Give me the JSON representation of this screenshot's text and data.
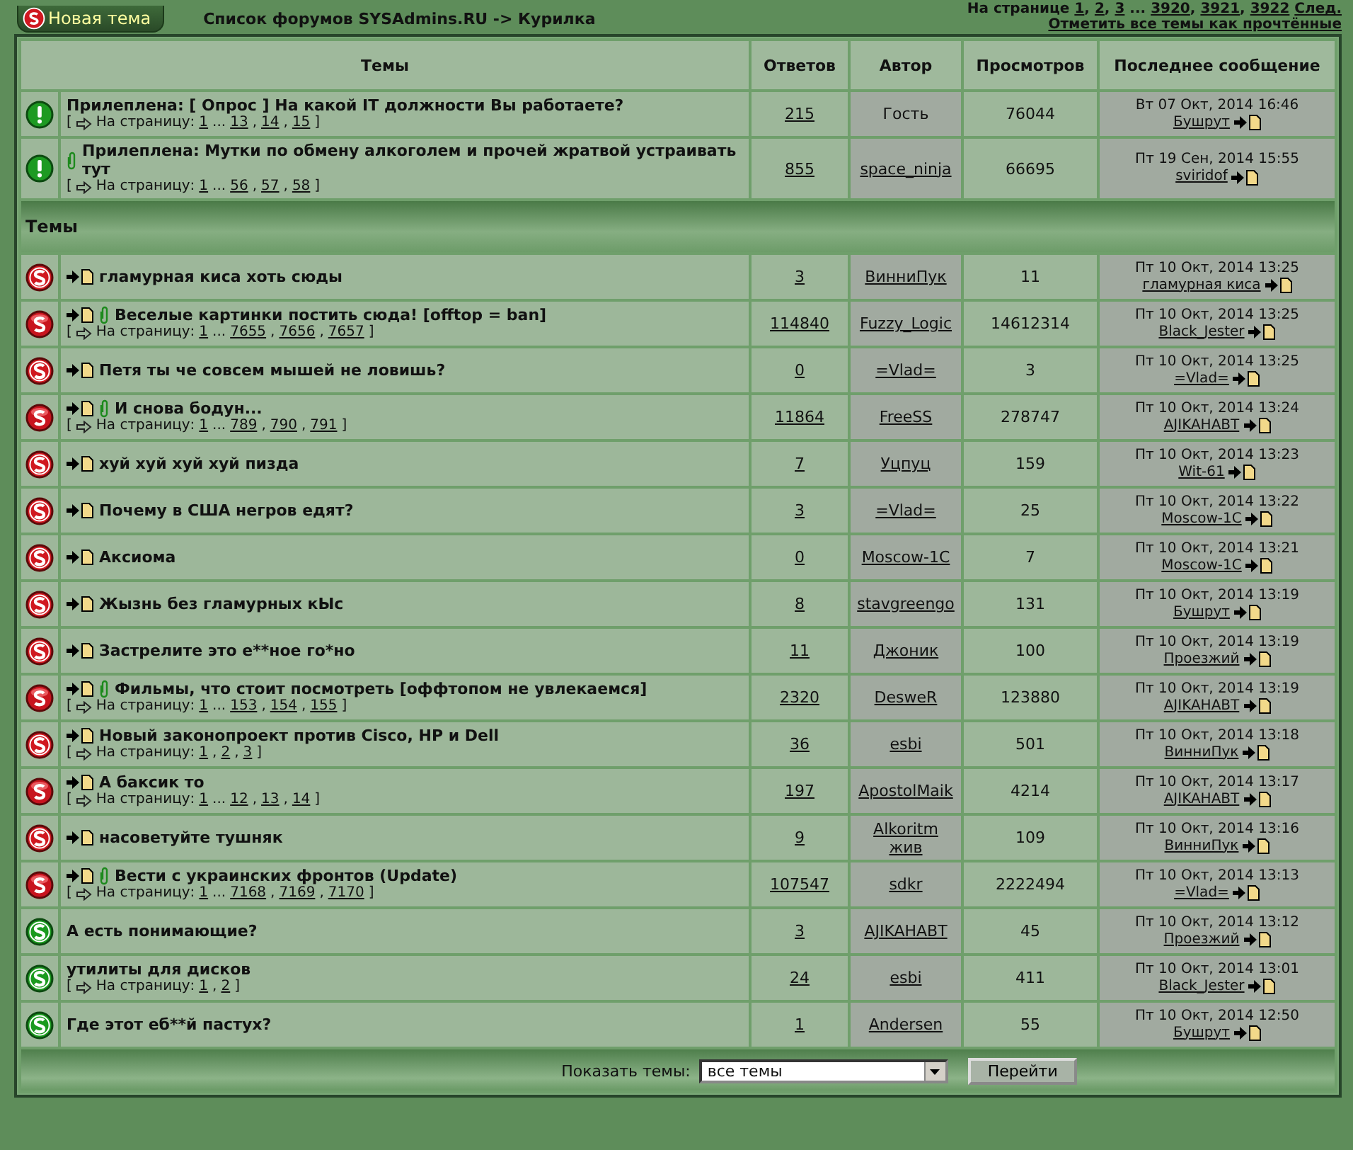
{
  "header": {
    "new_topic_button": "Новая тема",
    "breadcrumb": "Список форумов SYSAdmins.RU -> Курилка",
    "pager": {
      "label": "На странице",
      "links": [
        {
          "text": "1",
          "after": ","
        },
        {
          "text": "2",
          "after": ","
        },
        {
          "text": "3",
          "after": " ..."
        },
        {
          "text": "3920",
          "after": ","
        },
        {
          "text": "3921",
          "after": ","
        },
        {
          "text": "3922"
        }
      ],
      "next": "След."
    },
    "mark_read": "Отметить все темы как прочтённые"
  },
  "columns": [
    "Темы",
    "Ответов",
    "Автор",
    "Просмотров",
    "Последнее сообщение"
  ],
  "sticky_topics": [
    {
      "kind": "sticky",
      "new_posts": false,
      "attachment": false,
      "title": "Прилеплена: [ Опрос ] На какой IT должности Вы работаете?",
      "pager": {
        "open": "[",
        "label": "На страницу:",
        "links": [
          {
            "text": "1",
            "after": " ..."
          },
          {
            "text": "13",
            "after": ","
          },
          {
            "text": "14",
            "after": ","
          },
          {
            "text": "15"
          }
        ],
        "close": "]"
      },
      "replies": "215",
      "author": "Гость",
      "author_linked": false,
      "views": "76044",
      "last_date": "Вт 07 Окт, 2014 16:46",
      "last_user": "Бушрут"
    },
    {
      "kind": "sticky",
      "new_posts": false,
      "attachment": true,
      "title": "Прилеплена: Мутки по обмену алкоголем и прочей жратвой устраивать тут",
      "pager": {
        "open": "[",
        "label": "На страницу:",
        "links": [
          {
            "text": "1",
            "after": " ..."
          },
          {
            "text": "56",
            "after": ","
          },
          {
            "text": "57",
            "after": ","
          },
          {
            "text": "58"
          }
        ],
        "close": "]"
      },
      "replies": "855",
      "author": "space_ninja",
      "author_linked": true,
      "views": "66695",
      "last_date": "Пт 19 Сен, 2014 15:55",
      "last_user": "sviridof"
    }
  ],
  "section_title": "Темы",
  "topics": [
    {
      "kind": "hot",
      "new_posts": true,
      "attachment": false,
      "title": "гламурная киса хоть сюды",
      "replies": "3",
      "author": "ВинниПук",
      "author_linked": true,
      "views": "11",
      "last_date": "Пт 10 Окт, 2014 13:25",
      "last_user": "гламурная киса"
    },
    {
      "kind": "hot_paged",
      "new_posts": true,
      "attachment": true,
      "title": "Веселые картинки постить сюда! [offtop = ban]",
      "pager": {
        "open": "[",
        "label": "На страницу:",
        "links": [
          {
            "text": "1",
            "after": " ..."
          },
          {
            "text": "7655",
            "after": ","
          },
          {
            "text": "7656",
            "after": ","
          },
          {
            "text": "7657"
          }
        ],
        "close": "]"
      },
      "replies": "114840",
      "author": "Fuzzy_Logic",
      "author_linked": true,
      "views": "14612314",
      "last_date": "Пт 10 Окт, 2014 13:25",
      "last_user": "Black_Jester"
    },
    {
      "kind": "hot",
      "new_posts": true,
      "attachment": false,
      "title": "Петя ты че совсем мышей не ловишь?",
      "replies": "0",
      "author": "=Vlad=",
      "author_linked": true,
      "views": "3",
      "last_date": "Пт 10 Окт, 2014 13:25",
      "last_user": "=Vlad="
    },
    {
      "kind": "hot_paged",
      "new_posts": true,
      "attachment": true,
      "title": "И снова бодун...",
      "pager": {
        "open": "[",
        "label": "На страницу:",
        "links": [
          {
            "text": "1",
            "after": " ..."
          },
          {
            "text": "789",
            "after": ","
          },
          {
            "text": "790",
            "after": ","
          },
          {
            "text": "791"
          }
        ],
        "close": "]"
      },
      "replies": "11864",
      "author": "FreeSS",
      "author_linked": true,
      "views": "278747",
      "last_date": "Пт 10 Окт, 2014 13:24",
      "last_user": "AJIKAHABT"
    },
    {
      "kind": "hot",
      "new_posts": true,
      "attachment": false,
      "title": "хуй хуй хуй хуй пизда",
      "replies": "7",
      "author": "Уцпуц",
      "author_linked": true,
      "views": "159",
      "last_date": "Пт 10 Окт, 2014 13:23",
      "last_user": "Wit-61"
    },
    {
      "kind": "hot",
      "new_posts": true,
      "attachment": false,
      "title": "Почему в США негров едят?",
      "replies": "3",
      "author": "=Vlad=",
      "author_linked": true,
      "views": "25",
      "last_date": "Пт 10 Окт, 2014 13:22",
      "last_user": "Moscow-1C"
    },
    {
      "kind": "hot",
      "new_posts": true,
      "attachment": false,
      "title": "Аксиома",
      "replies": "0",
      "author": "Moscow-1C",
      "author_linked": true,
      "views": "7",
      "last_date": "Пт 10 Окт, 2014 13:21",
      "last_user": "Moscow-1C"
    },
    {
      "kind": "hot",
      "new_posts": true,
      "attachment": false,
      "title": "Жызнь без гламурных кЫс",
      "replies": "8",
      "author": "stavgreengo",
      "author_linked": true,
      "views": "131",
      "last_date": "Пт 10 Окт, 2014 13:19",
      "last_user": "Бушрут"
    },
    {
      "kind": "hot",
      "new_posts": true,
      "attachment": false,
      "title": "Застрелите это е**ное го*но",
      "replies": "11",
      "author": "Джоник",
      "author_linked": true,
      "views": "100",
      "last_date": "Пт 10 Окт, 2014 13:19",
      "last_user": "Проезжий"
    },
    {
      "kind": "hot_paged",
      "new_posts": true,
      "attachment": true,
      "title": "Фильмы, что стоит посмотреть [оффтопом не увлекаемся]",
      "pager": {
        "open": "[",
        "label": "На страницу:",
        "links": [
          {
            "text": "1",
            "after": " ..."
          },
          {
            "text": "153",
            "after": ","
          },
          {
            "text": "154",
            "after": ","
          },
          {
            "text": "155"
          }
        ],
        "close": "]"
      },
      "replies": "2320",
      "author": "DesweR",
      "author_linked": true,
      "views": "123880",
      "last_date": "Пт 10 Окт, 2014 13:19",
      "last_user": "AJIKAHABT"
    },
    {
      "kind": "hot",
      "new_posts": true,
      "attachment": false,
      "title": "Новый законопроект против Cisco, HP и Dell",
      "pager": {
        "open": "[",
        "label": "На страницу:",
        "links": [
          {
            "text": "1",
            "after": ","
          },
          {
            "text": "2",
            "after": ","
          },
          {
            "text": "3"
          }
        ],
        "close": "]"
      },
      "replies": "36",
      "author": "esbi",
      "author_linked": true,
      "views": "501",
      "last_date": "Пт 10 Окт, 2014 13:18",
      "last_user": "ВинниПук"
    },
    {
      "kind": "hot_paged",
      "new_posts": true,
      "attachment": false,
      "title": "А баксик то",
      "pager": {
        "open": "[",
        "label": "На страницу:",
        "links": [
          {
            "text": "1",
            "after": " ..."
          },
          {
            "text": "12",
            "after": ","
          },
          {
            "text": "13",
            "after": ","
          },
          {
            "text": "14"
          }
        ],
        "close": "]"
      },
      "replies": "197",
      "author": "ApostolMaik",
      "author_linked": true,
      "views": "4214",
      "last_date": "Пт 10 Окт, 2014 13:17",
      "last_user": "AJIKAHABT"
    },
    {
      "kind": "hot",
      "new_posts": true,
      "attachment": false,
      "title": "насоветуйте тушняк",
      "replies": "9",
      "author": "Alkoritm жив",
      "author_linked": true,
      "views": "109",
      "last_date": "Пт 10 Окт, 2014 13:16",
      "last_user": "ВинниПук"
    },
    {
      "kind": "hot_paged",
      "new_posts": true,
      "attachment": true,
      "title": "Вести с украинских фронтов (Update)",
      "pager": {
        "open": "[",
        "label": "На страницу:",
        "links": [
          {
            "text": "1",
            "after": " ..."
          },
          {
            "text": "7168",
            "after": ","
          },
          {
            "text": "7169",
            "after": ","
          },
          {
            "text": "7170"
          }
        ],
        "close": "]"
      },
      "replies": "107547",
      "author": "sdkr",
      "author_linked": true,
      "views": "2222494",
      "last_date": "Пт 10 Окт, 2014 13:13",
      "last_user": "=Vlad="
    },
    {
      "kind": "normal",
      "new_posts": false,
      "attachment": false,
      "title": "А есть понимающие?",
      "replies": "3",
      "author": "AJIKAHABT",
      "author_linked": true,
      "views": "45",
      "last_date": "Пт 10 Окт, 2014 13:12",
      "last_user": "Проезжий"
    },
    {
      "kind": "normal",
      "new_posts": false,
      "attachment": false,
      "title": "утилиты для дисков",
      "pager": {
        "open": "[",
        "label": "На страницу:",
        "links": [
          {
            "text": "1",
            "after": ","
          },
          {
            "text": "2"
          }
        ],
        "close": "]"
      },
      "replies": "24",
      "author": "esbi",
      "author_linked": true,
      "views": "411",
      "last_date": "Пт 10 Окт, 2014 13:01",
      "last_user": "Black_Jester"
    },
    {
      "kind": "normal",
      "new_posts": false,
      "attachment": false,
      "title": "Где этот еб**й пастух?",
      "replies": "1",
      "author": "Andersen",
      "author_linked": true,
      "views": "55",
      "last_date": "Пт 10 Окт, 2014 12:50",
      "last_user": "Бушрут"
    }
  ],
  "footer": {
    "filter_label": "Показать темы:",
    "filter_value": "все темы",
    "go_button": "Перейти"
  }
}
